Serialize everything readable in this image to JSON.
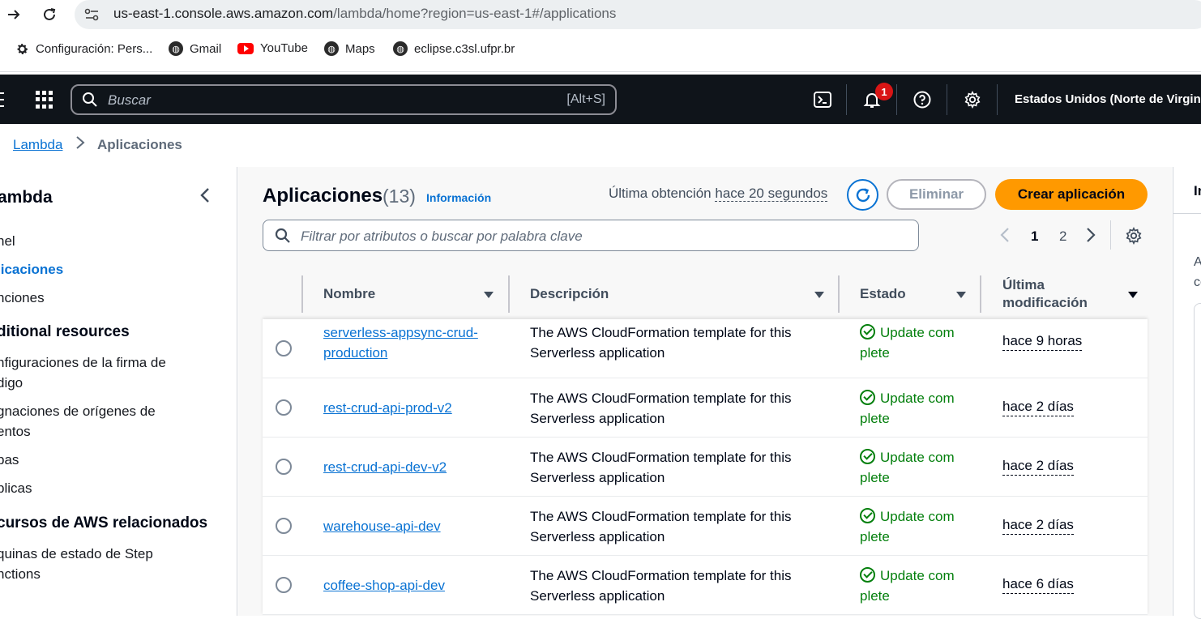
{
  "browser": {
    "url_host": "us-east-1.console.aws.amazon.com",
    "url_path": "/lambda/home?region=us-east-1#/applications",
    "bookmarks": [
      {
        "label": "Configuración: Pers...",
        "icon": "gear-icon"
      },
      {
        "label": "Gmail",
        "icon": "globe-icon"
      },
      {
        "label": "YouTube",
        "icon": "youtube-icon"
      },
      {
        "label": "Maps",
        "icon": "globe-icon"
      },
      {
        "label": "eclipse.c3sl.ufpr.br",
        "icon": "globe-icon"
      }
    ]
  },
  "aws_bar": {
    "search_placeholder": "Buscar",
    "search_shortcut": "[Alt+S]",
    "notification_count": "1",
    "region": "Estados Unidos (Norte de Virginia"
  },
  "breadcrumb": {
    "root": "Lambda",
    "current": "Aplicaciones"
  },
  "sidebar": {
    "title": "ambda",
    "items": [
      {
        "label": "nel",
        "active": false
      },
      {
        "label": "licaciones",
        "active": true
      },
      {
        "label": "nciones",
        "active": false
      }
    ],
    "section_additional": "ditional resources",
    "additional_items": [
      {
        "label": "nfiguraciones de la firma de"
      },
      {
        "label": "digo"
      },
      {
        "label": "gnaciones de orígenes de"
      },
      {
        "label": "entos"
      },
      {
        "label": "pas"
      },
      {
        "label": "plicas"
      }
    ],
    "section_related": "cursos de AWS relacionados",
    "related_items": [
      {
        "label": "quinas de estado de Step"
      },
      {
        "label": "nctions"
      }
    ]
  },
  "main": {
    "title": "Aplicaciones",
    "count": "(13)",
    "info_link": "Información",
    "last_fetch_label": "Última obtención",
    "last_fetch_ago": "hace 20 segundos",
    "delete_label": "Eliminar",
    "create_label": "Crear aplicación",
    "filter_placeholder": "Filtrar por atributos o buscar por palabra clave",
    "pages": [
      "1",
      "2"
    ],
    "columns": {
      "name": "Nombre",
      "description": "Descripción",
      "status": "Estado",
      "modified_line1": "Última",
      "modified_line2": "modificación"
    },
    "rows": [
      {
        "name_line1": "serverless-appsync-crud-",
        "name_line2": "production",
        "desc_line1": "The AWS CloudFormation template for this",
        "desc_line2": "Serverless application",
        "status_line1": "Update com",
        "status_line2": "plete",
        "modified": "hace 9 horas"
      },
      {
        "name_line1": "rest-crud-api-prod-v2",
        "name_line2": "",
        "desc_line1": "The AWS CloudFormation template for this",
        "desc_line2": "Serverless application",
        "status_line1": "Update com",
        "status_line2": "plete",
        "modified": "hace 2 días"
      },
      {
        "name_line1": "rest-crud-api-dev-v2",
        "name_line2": "",
        "desc_line1": "The AWS CloudFormation template for this",
        "desc_line2": "Serverless application",
        "status_line1": "Update com",
        "status_line2": "plete",
        "modified": "hace 2 días"
      },
      {
        "name_line1": "warehouse-api-dev",
        "name_line2": "",
        "desc_line1": "The AWS CloudFormation template for this",
        "desc_line2": "Serverless application",
        "status_line1": "Update com",
        "status_line2": "plete",
        "modified": "hace 2 días"
      },
      {
        "name_line1": "coffee-shop-api-dev",
        "name_line2": "",
        "desc_line1": "The AWS CloudFormation template for this",
        "desc_line2": "Serverless application",
        "status_line1": "Update com",
        "status_line2": "plete",
        "modified": "hace 6 días"
      }
    ]
  },
  "right_panel": {
    "head": "In",
    "text_line1": "A",
    "text_line2": "co"
  },
  "colors": {
    "aws_dark": "#0f141a",
    "link_blue": "#0972d3",
    "accent_orange": "#ff9900",
    "success_green": "#037f0c"
  }
}
